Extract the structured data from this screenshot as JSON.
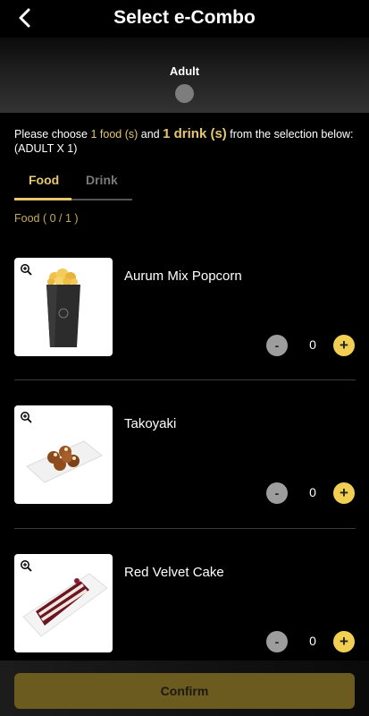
{
  "header": {
    "title": "Select e-Combo",
    "back_icon": "chevron-left-icon"
  },
  "ticket": {
    "label": "Adult"
  },
  "instruction": {
    "part1": "Please choose ",
    "food_req": "1 food (s)",
    "part2": " and ",
    "drink_req": "1 drink (s)",
    "part3": " from the selection below: (ADULT X 1)"
  },
  "tabs": [
    {
      "label": "Food",
      "active": true
    },
    {
      "label": "Drink",
      "active": false
    }
  ],
  "food_count": "Food ( 0 / 1 )",
  "items": [
    {
      "name": "Aurum Mix Popcorn",
      "qty": "0",
      "minus": "-",
      "plus": "+",
      "image": "popcorn-image"
    },
    {
      "name": "Takoyaki",
      "qty": "0",
      "minus": "-",
      "plus": "+",
      "image": "takoyaki-image"
    },
    {
      "name": "Red Velvet Cake",
      "qty": "0",
      "minus": "-",
      "plus": "+",
      "image": "cake-image"
    }
  ],
  "confirm_label": "Confirm",
  "colors": {
    "accent": "#e6c76f",
    "plus_button": "#f1cf53",
    "minus_button": "#9d9d9d",
    "confirm_bg": "#6b5b1e"
  }
}
